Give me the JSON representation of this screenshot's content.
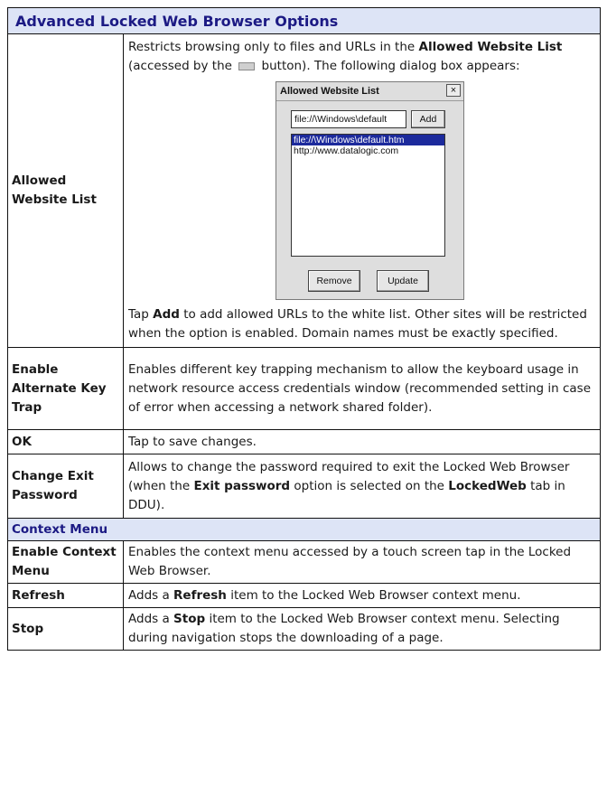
{
  "header": {
    "title": "Advanced Locked Web Browser Options"
  },
  "rows": [
    {
      "label": "Allowed Website List",
      "desc_parts": [
        "Restricts browsing only to files and URLs in the ",
        "Allowed Website List",
        " (accessed by the ",
        " button). The following dialog box appears:"
      ],
      "after_parts": [
        "Tap ",
        "Add",
        " to add allowed URLs to the white list. Other sites will be restricted when the option is enabled. Domain names must be exactly specified."
      ]
    },
    {
      "label": "Enable Alternate Key Trap",
      "desc": "Enables different key trapping mechanism to allow the keyboard usage in network resource access credentials window (recommended setting in case of error when accessing a network shared folder)."
    },
    {
      "label": "OK",
      "desc": "Tap to save changes."
    },
    {
      "label": "Change Exit Password",
      "desc_parts": [
        "Allows to change the password required to exit the Locked Web Browser (when the ",
        "Exit password",
        " option is selected on the ",
        "LockedWeb",
        " tab in DDU)."
      ]
    }
  ],
  "section2": {
    "title": "Context Menu"
  },
  "rows2": [
    {
      "label": "Enable Context Menu",
      "desc": "Enables the context menu accessed by a touch screen tap in the Locked Web Browser."
    },
    {
      "label": "Refresh",
      "desc_parts": [
        "Adds a ",
        "Refresh",
        " item to the Locked Web Browser context menu."
      ]
    },
    {
      "label": "Stop",
      "desc_parts": [
        "Adds a ",
        "Stop",
        " item to the Locked Web Browser context menu. Selecting during navigation stops the downloading of a page."
      ]
    }
  ],
  "dialog": {
    "title": "Allowed Website List",
    "close": "×",
    "input_value": "file://\\Windows\\default",
    "add_label": "Add",
    "list_items": [
      "file://\\Windows\\default.htm",
      "http://www.datalogic.com"
    ],
    "remove_label": "Remove",
    "update_label": "Update"
  },
  "icons": {
    "browse_button": "ellipsis-button-icon"
  },
  "colors": {
    "header_bg": "#dde4f6",
    "header_text": "#1c1a84",
    "selection": "#1c2a9c"
  }
}
